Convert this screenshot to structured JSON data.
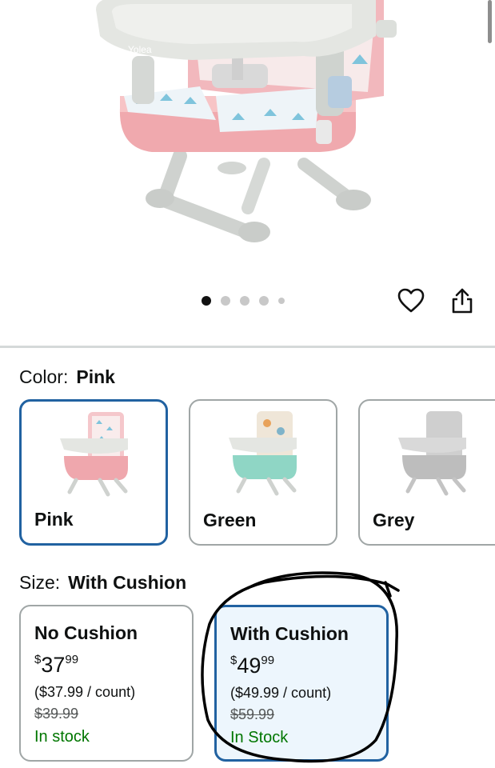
{
  "product_image": {
    "brand_text": "Yolea",
    "alt": "booster-seat-image"
  },
  "carousel": {
    "count": 5,
    "active_index": 0
  },
  "color": {
    "label": "Color:",
    "selected_value": "Pink",
    "options": [
      {
        "name": "Pink",
        "seat_color": "#efa7ad",
        "pad_color": "#f3d6da",
        "selected": true
      },
      {
        "name": "Green",
        "seat_color": "#8fd6c5",
        "pad_color": "#f1e8dc",
        "selected": false
      },
      {
        "name": "Grey",
        "seat_color": "#bfbfbf",
        "pad_color": "#d5d5d5",
        "selected": false
      }
    ]
  },
  "size": {
    "label": "Size:",
    "selected_value": "With Cushion",
    "options": [
      {
        "name": "No Cushion",
        "price_currency": "$",
        "price_whole": "37",
        "price_fraction": "99",
        "unit_price": "($37.99 / count)",
        "list_price": "$39.99",
        "availability": "In stock",
        "selected": false
      },
      {
        "name": "With Cushion",
        "price_currency": "$",
        "price_whole": "49",
        "price_fraction": "99",
        "unit_price": "($49.99 / count)",
        "list_price": "$59.99",
        "availability": "In Stock",
        "selected": true
      }
    ]
  },
  "colors": {
    "accent": "#2162a1",
    "in_stock": "#007600",
    "selected_bg": "#edf6fd"
  }
}
